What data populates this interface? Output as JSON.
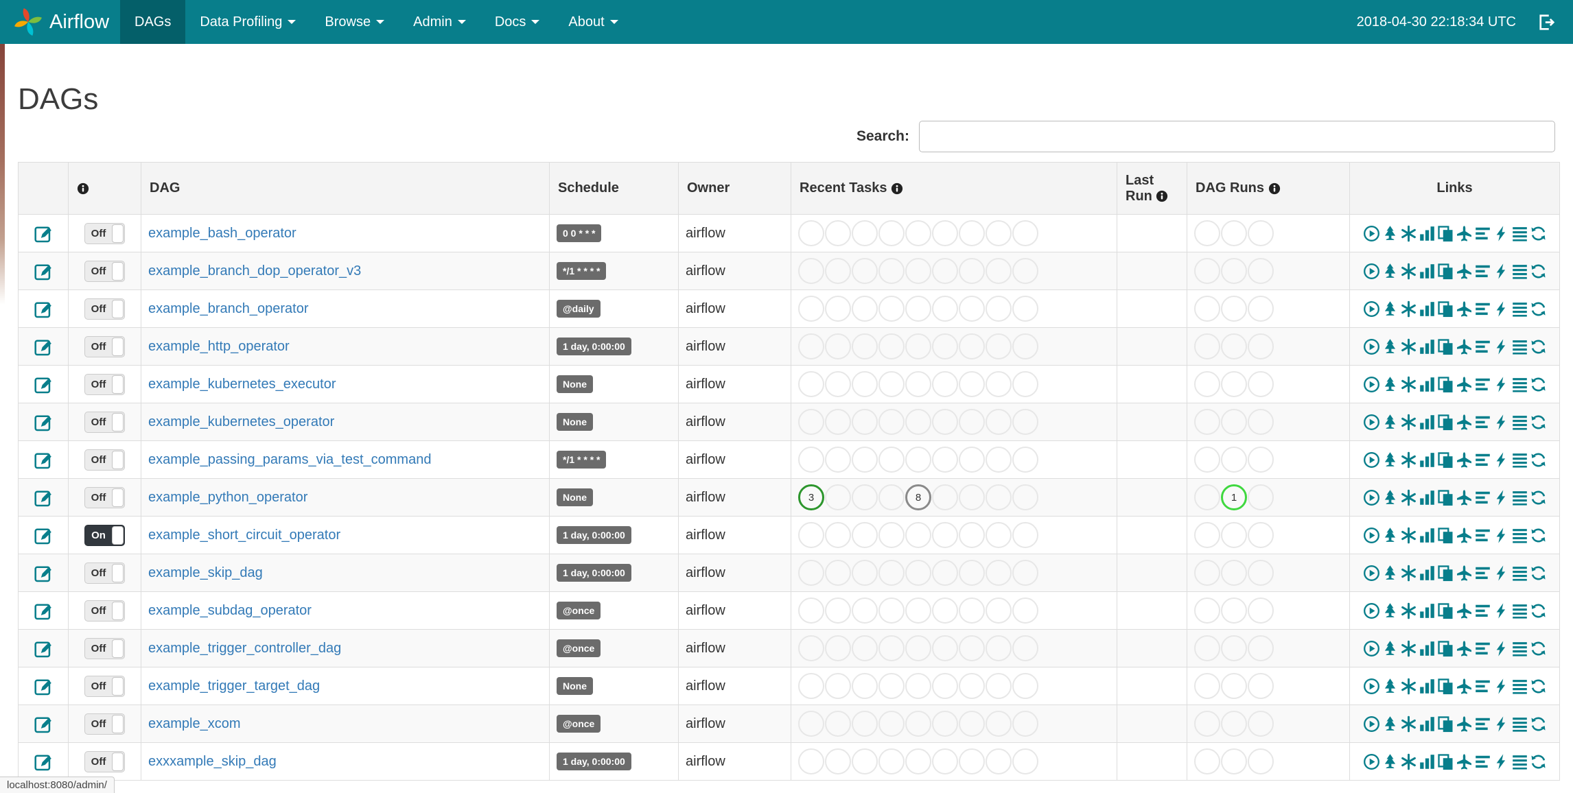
{
  "navbar": {
    "brand": "Airflow",
    "items": [
      {
        "label": "DAGs",
        "active": true,
        "dropdown": false
      },
      {
        "label": "Data Profiling",
        "active": false,
        "dropdown": true
      },
      {
        "label": "Browse",
        "active": false,
        "dropdown": true
      },
      {
        "label": "Admin",
        "active": false,
        "dropdown": true
      },
      {
        "label": "Docs",
        "active": false,
        "dropdown": true
      },
      {
        "label": "About",
        "active": false,
        "dropdown": true
      }
    ],
    "clock": "2018-04-30 22:18:34 UTC"
  },
  "page": {
    "title": "DAGs",
    "search_label": "Search:",
    "status_bar": "localhost:8080/admin/"
  },
  "colors": {
    "navbar_teal": "#087e8b",
    "navbar_active": "#045f69",
    "icon_teal": "#087e8b",
    "dag_link_blue": "#337ab7",
    "success_green": "#2d962d",
    "running_green": "#3fd83f",
    "queued_gray": "#8a8a8a"
  },
  "table": {
    "headers": {
      "dag": "DAG",
      "schedule": "Schedule",
      "owner": "Owner",
      "recent_tasks": "Recent Tasks",
      "last_run": "Last Run",
      "dag_runs": "DAG Runs",
      "links": "Links"
    },
    "toggle_on": "On",
    "toggle_off": "Off",
    "recent_slots": 9,
    "run_slots": 3,
    "link_icons": [
      "trigger-dag-icon",
      "tree-view-icon",
      "graph-view-icon",
      "task-duration-icon",
      "task-tries-icon",
      "landing-times-icon",
      "gantt-view-icon",
      "code-view-icon",
      "log-icon",
      "refresh-icon"
    ],
    "rows": [
      {
        "name": "example_bash_operator",
        "toggle": "off",
        "schedule": "0 0 * * *",
        "owner": "airflow",
        "recent_tasks": [],
        "dag_runs": []
      },
      {
        "name": "example_branch_dop_operator_v3",
        "toggle": "off",
        "schedule": "*/1 * * * *",
        "owner": "airflow",
        "recent_tasks": [],
        "dag_runs": []
      },
      {
        "name": "example_branch_operator",
        "toggle": "off",
        "schedule": "@daily",
        "owner": "airflow",
        "recent_tasks": [],
        "dag_runs": []
      },
      {
        "name": "example_http_operator",
        "toggle": "off",
        "schedule": "1 day, 0:00:00",
        "owner": "airflow",
        "recent_tasks": [],
        "dag_runs": []
      },
      {
        "name": "example_kubernetes_executor",
        "toggle": "off",
        "schedule": "None",
        "owner": "airflow",
        "recent_tasks": [],
        "dag_runs": []
      },
      {
        "name": "example_kubernetes_operator",
        "toggle": "off",
        "schedule": "None",
        "owner": "airflow",
        "recent_tasks": [],
        "dag_runs": []
      },
      {
        "name": "example_passing_params_via_test_command",
        "toggle": "off",
        "schedule": "*/1 * * * *",
        "owner": "airflow",
        "recent_tasks": [],
        "dag_runs": []
      },
      {
        "name": "example_python_operator",
        "toggle": "off",
        "schedule": "None",
        "owner": "airflow",
        "recent_tasks": [
          {
            "slot": 0,
            "count": "3",
            "color": "#2d962d"
          },
          {
            "slot": 4,
            "count": "8",
            "color": "#8a8a8a"
          }
        ],
        "dag_runs": [
          {
            "slot": 1,
            "count": "1",
            "color": "#3fd83f"
          }
        ]
      },
      {
        "name": "example_short_circuit_operator",
        "toggle": "on",
        "schedule": "1 day, 0:00:00",
        "owner": "airflow",
        "recent_tasks": [],
        "dag_runs": []
      },
      {
        "name": "example_skip_dag",
        "toggle": "off",
        "schedule": "1 day, 0:00:00",
        "owner": "airflow",
        "recent_tasks": [],
        "dag_runs": []
      },
      {
        "name": "example_subdag_operator",
        "toggle": "off",
        "schedule": "@once",
        "owner": "airflow",
        "recent_tasks": [],
        "dag_runs": []
      },
      {
        "name": "example_trigger_controller_dag",
        "toggle": "off",
        "schedule": "@once",
        "owner": "airflow",
        "recent_tasks": [],
        "dag_runs": []
      },
      {
        "name": "example_trigger_target_dag",
        "toggle": "off",
        "schedule": "None",
        "owner": "airflow",
        "recent_tasks": [],
        "dag_runs": []
      },
      {
        "name": "example_xcom",
        "toggle": "off",
        "schedule": "@once",
        "owner": "airflow",
        "recent_tasks": [],
        "dag_runs": []
      },
      {
        "name": "exxxample_skip_dag",
        "toggle": "off",
        "schedule": "1 day, 0:00:00",
        "owner": "airflow",
        "recent_tasks": [],
        "dag_runs": []
      }
    ]
  }
}
